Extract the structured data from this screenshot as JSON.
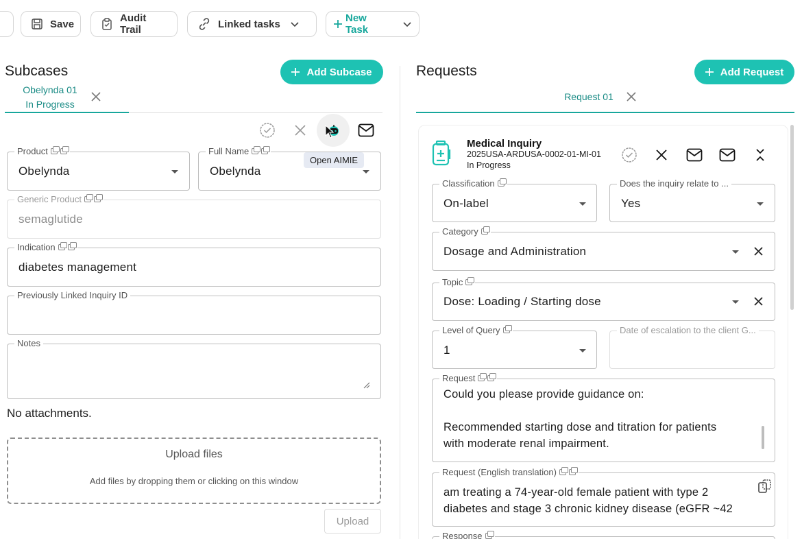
{
  "toolbar": {
    "save_label": "Save",
    "audit_label": "Audit Trail",
    "linked_label": "Linked tasks",
    "new_task_label": "New Task"
  },
  "subcases": {
    "title": "Subcases",
    "add_label": "Add Subcase",
    "tab": {
      "name": "Obelynda 01",
      "status": "In Progress"
    },
    "tooltip": "Open AIMIE",
    "fields": {
      "product": {
        "label": "Product",
        "value": "Obelynda"
      },
      "full_name": {
        "label": "Full Name",
        "value": "Obelynda"
      },
      "generic": {
        "label": "Generic Product",
        "value": "semaglutide"
      },
      "indication": {
        "label": "Indication",
        "value": "diabetes management"
      },
      "prev_linked": {
        "label": "Previously Linked Inquiry ID",
        "value": ""
      },
      "notes": {
        "label": "Notes",
        "value": ""
      }
    },
    "no_attachments": "No attachments.",
    "upload": {
      "title": "Upload files",
      "subtitle": "Add files by dropping them or clicking on this window",
      "button": "Upload"
    }
  },
  "requests": {
    "title": "Requests",
    "add_label": "Add Request",
    "tab": "Request 01",
    "card": {
      "title": "Medical Inquiry",
      "id": "2025USA-ARDUSA-0002-01-MI-01",
      "status": "In Progress"
    },
    "fields": {
      "classification": {
        "label": "Classification",
        "value": "On-label"
      },
      "relates": {
        "label": "Does the inquiry relate to ...",
        "value": "Yes"
      },
      "category": {
        "label": "Category",
        "value": "Dosage and Administration"
      },
      "topic": {
        "label": "Topic",
        "value": "Dose: Loading / Starting dose"
      },
      "level": {
        "label": "Level of Query",
        "value": "1"
      },
      "escalation": {
        "label": "Date of escalation to the client G...",
        "value": ""
      },
      "request": {
        "label": "Request",
        "line1": "Could you please provide guidance on:",
        "line2": "",
        "line3": "Recommended starting dose and titration for patients",
        "line4": "with moderate renal impairment."
      },
      "request_en": {
        "label": "Request (English translation)",
        "line1": " am treating a 74-year-old female patient with type 2",
        "line2": "diabetes and stage 3 chronic kidney disease (eGFR ~42"
      },
      "response": {
        "label": "Response"
      }
    }
  },
  "colors": {
    "accent": "#1ec2b3",
    "accent_text": "#17a79c"
  }
}
